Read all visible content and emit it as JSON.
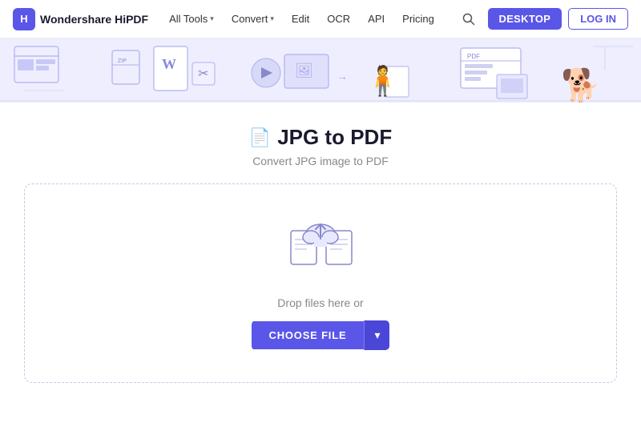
{
  "navbar": {
    "logo_text": "Wondershare HiPDF",
    "all_tools_label": "All Tools",
    "convert_label": "Convert",
    "edit_label": "Edit",
    "ocr_label": "OCR",
    "api_label": "API",
    "pricing_label": "Pricing",
    "desktop_button": "DESKTOP",
    "login_button": "LOG IN"
  },
  "main": {
    "page_title": "JPG to PDF",
    "page_subtitle": "Convert JPG image to PDF",
    "drop_text": "Drop files here or",
    "choose_file_label": "CHOOSE FILE"
  },
  "colors": {
    "accent": "#5a56e8",
    "banner_bg": "#eeeeff"
  }
}
